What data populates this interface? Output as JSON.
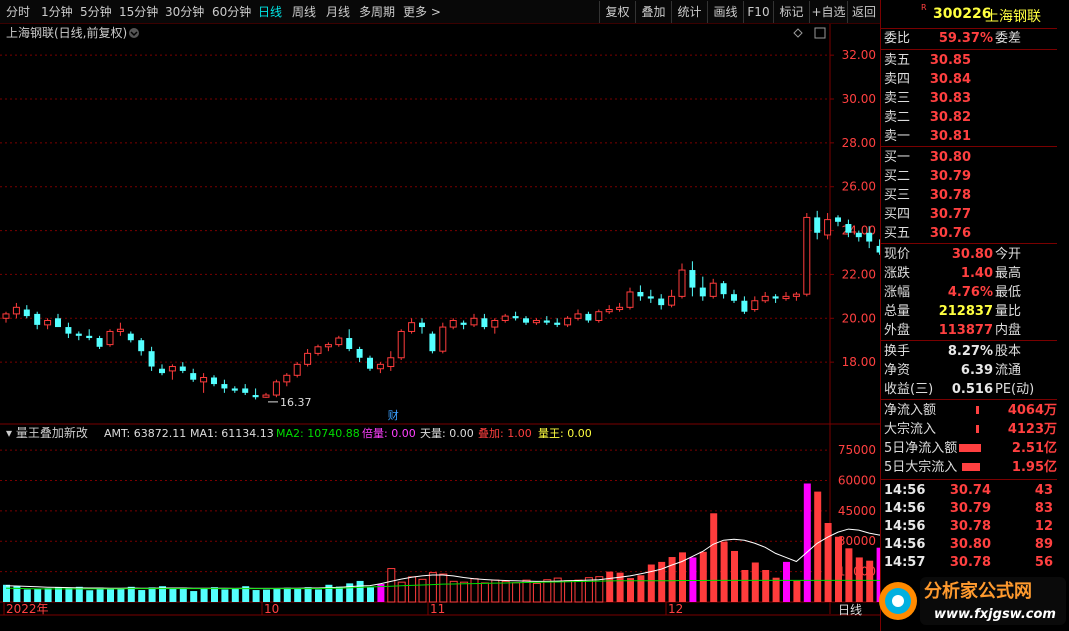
{
  "toolbar": {
    "periods": [
      "分时",
      "1分钟",
      "5分钟",
      "15分钟",
      "30分钟",
      "60分钟",
      "日线",
      "周线",
      "月线",
      "多周期",
      "更多 >"
    ],
    "selected": "日线",
    "actions": [
      "复权",
      "叠加",
      "统计",
      "画线",
      "F10",
      "标记",
      "+自选",
      "返回"
    ]
  },
  "main_chart": {
    "title": "上海钢联(日线,前复权)",
    "high_label": "32.00",
    "low_label": "16.37",
    "fin_marker": "财",
    "y_ticks": [
      "32.00",
      "30.00",
      "28.00",
      "26.00",
      "24.00",
      "22.00",
      "20.00",
      "18.00"
    ]
  },
  "indicator": {
    "name": "量王叠加新改",
    "amt": "AMT: 63872.11",
    "ma1": "MA1: 61134.13",
    "ma2": "MA2: 10740.88",
    "beiliang": "倍量: 0.00",
    "tianliang": "天量: 0.00",
    "diejia": "叠加: 1.00",
    "liangwang": "量王: 0.00",
    "y_ticks": [
      "75000",
      "60000",
      "45000",
      "30000",
      "15000"
    ]
  },
  "x_axis": {
    "labels": [
      "2022年",
      "10",
      "11",
      "12"
    ],
    "right_label": "日线"
  },
  "chart_data": {
    "type": "bar",
    "price_scale": [
      16.0,
      32.6
    ],
    "candles": [
      [
        20.0,
        20.3,
        19.8,
        20.2
      ],
      [
        20.2,
        20.7,
        20.0,
        20.5
      ],
      [
        20.4,
        20.6,
        20.0,
        20.1
      ],
      [
        20.2,
        20.3,
        19.5,
        19.7
      ],
      [
        19.7,
        20.0,
        19.5,
        19.9
      ],
      [
        20.0,
        20.2,
        19.6,
        19.6
      ],
      [
        19.6,
        19.8,
        19.1,
        19.3
      ],
      [
        19.3,
        19.4,
        19.0,
        19.2
      ],
      [
        19.2,
        19.5,
        19.0,
        19.1
      ],
      [
        19.1,
        19.2,
        18.6,
        18.7
      ],
      [
        18.8,
        19.5,
        18.7,
        19.4
      ],
      [
        19.4,
        19.8,
        19.2,
        19.5
      ],
      [
        19.3,
        19.4,
        18.9,
        19.0
      ],
      [
        19.0,
        19.1,
        18.3,
        18.5
      ],
      [
        18.5,
        18.7,
        17.6,
        17.8
      ],
      [
        17.7,
        17.9,
        17.4,
        17.5
      ],
      [
        17.6,
        17.9,
        17.2,
        17.8
      ],
      [
        17.8,
        18.0,
        17.5,
        17.6
      ],
      [
        17.5,
        17.7,
        17.1,
        17.2
      ],
      [
        17.1,
        17.5,
        16.6,
        17.3
      ],
      [
        17.3,
        17.4,
        16.9,
        17.0
      ],
      [
        17.0,
        17.2,
        16.6,
        16.8
      ],
      [
        16.8,
        16.9,
        16.6,
        16.7
      ],
      [
        16.8,
        17.0,
        16.5,
        16.6
      ],
      [
        16.5,
        16.8,
        16.3,
        16.4
      ],
      [
        16.4,
        16.6,
        16.37,
        16.5
      ],
      [
        16.5,
        17.2,
        16.4,
        17.1
      ],
      [
        17.1,
        17.5,
        16.9,
        17.4
      ],
      [
        17.4,
        18.0,
        17.3,
        17.9
      ],
      [
        17.9,
        18.6,
        17.8,
        18.4
      ],
      [
        18.4,
        18.8,
        18.3,
        18.7
      ],
      [
        18.7,
        18.9,
        18.5,
        18.8
      ],
      [
        18.8,
        19.2,
        18.7,
        19.1
      ],
      [
        19.1,
        19.5,
        18.5,
        18.6
      ],
      [
        18.6,
        18.7,
        18.0,
        18.2
      ],
      [
        18.2,
        18.3,
        17.6,
        17.7
      ],
      [
        17.7,
        18.0,
        17.5,
        17.9
      ],
      [
        17.8,
        18.5,
        17.6,
        18.2
      ],
      [
        18.2,
        19.5,
        18.1,
        19.4
      ],
      [
        19.4,
        20.0,
        19.3,
        19.8
      ],
      [
        19.8,
        20.0,
        19.3,
        19.6
      ],
      [
        19.3,
        19.4,
        18.4,
        18.5
      ],
      [
        18.5,
        19.8,
        18.4,
        19.6
      ],
      [
        19.6,
        20.0,
        19.5,
        19.9
      ],
      [
        19.8,
        19.9,
        19.5,
        19.7
      ],
      [
        19.7,
        20.2,
        19.6,
        20.0
      ],
      [
        20.0,
        20.2,
        19.5,
        19.6
      ],
      [
        19.6,
        20.0,
        19.3,
        19.9
      ],
      [
        19.9,
        20.2,
        19.8,
        20.1
      ],
      [
        20.1,
        20.3,
        19.9,
        20.0
      ],
      [
        20.0,
        20.1,
        19.7,
        19.8
      ],
      [
        19.8,
        20.0,
        19.7,
        19.9
      ],
      [
        19.9,
        20.1,
        19.7,
        19.8
      ],
      [
        19.8,
        20.0,
        19.6,
        19.7
      ],
      [
        19.7,
        20.1,
        19.6,
        20.0
      ],
      [
        20.0,
        20.4,
        19.9,
        20.2
      ],
      [
        20.2,
        20.3,
        19.8,
        19.9
      ],
      [
        19.9,
        20.4,
        19.8,
        20.3
      ],
      [
        20.3,
        20.6,
        20.2,
        20.4
      ],
      [
        20.4,
        20.7,
        20.3,
        20.5
      ],
      [
        20.5,
        21.4,
        20.4,
        21.2
      ],
      [
        21.2,
        21.5,
        20.8,
        21.0
      ],
      [
        21.0,
        21.3,
        20.7,
        20.9
      ],
      [
        20.9,
        21.1,
        20.4,
        20.6
      ],
      [
        20.6,
        21.3,
        20.5,
        21.0
      ],
      [
        21.0,
        22.5,
        20.9,
        22.2
      ],
      [
        22.2,
        22.6,
        21.0,
        21.4
      ],
      [
        21.4,
        21.9,
        20.8,
        21.0
      ],
      [
        21.0,
        21.8,
        20.9,
        21.6
      ],
      [
        21.6,
        21.7,
        20.9,
        21.1
      ],
      [
        21.1,
        21.3,
        20.7,
        20.8
      ],
      [
        20.8,
        21.0,
        20.2,
        20.3
      ],
      [
        20.4,
        21.0,
        20.3,
        20.8
      ],
      [
        20.8,
        21.2,
        20.7,
        21.0
      ],
      [
        21.0,
        21.1,
        20.7,
        20.9
      ],
      [
        20.9,
        21.2,
        20.8,
        21.0
      ],
      [
        21.0,
        21.2,
        20.8,
        21.1
      ],
      [
        21.1,
        24.8,
        21.0,
        24.6
      ],
      [
        24.6,
        24.9,
        23.6,
        23.9
      ],
      [
        23.8,
        24.8,
        23.6,
        24.5
      ],
      [
        24.6,
        24.7,
        24.2,
        24.4
      ],
      [
        24.3,
        24.5,
        23.7,
        23.9
      ],
      [
        23.9,
        24.0,
        23.5,
        23.7
      ],
      [
        23.9,
        24.2,
        23.2,
        23.5
      ],
      [
        23.3,
        23.6,
        22.9,
        23.0
      ],
      [
        23.5,
        24.8,
        23.4,
        24.6
      ],
      [
        24.6,
        26.5,
        24.4,
        26.2
      ],
      [
        26.1,
        26.6,
        25.2,
        25.6
      ],
      [
        25.6,
        26.6,
        25.4,
        26.5
      ],
      [
        26.4,
        27.0,
        26.0,
        26.2
      ],
      [
        26.2,
        29.3,
        26.0,
        29.0
      ],
      [
        28.5,
        30.4,
        28.3,
        30.0
      ],
      [
        29.6,
        32.0,
        29.3,
        31.5
      ],
      [
        30.5,
        32.2,
        28.9,
        30.8
      ]
    ],
    "volume_scale": [
      0,
      78000
    ],
    "volumes": [
      8500,
      7800,
      6200,
      6500,
      6800,
      7200,
      6900,
      7500,
      5800,
      7100,
      6400,
      6800,
      7500,
      5900,
      7200,
      7800,
      6500,
      7100,
      5400,
      6900,
      7300,
      6200,
      6700,
      7800,
      5900,
      6100,
      6400,
      7000,
      6500,
      7300,
      6200,
      8500,
      7600,
      9200,
      10400,
      7200,
      8900,
      16500,
      9800,
      12400,
      11200,
      14500,
      13800,
      10200,
      9800,
      11500,
      9400,
      10800,
      10200,
      9500,
      10800,
      9200,
      11000,
      11800,
      10500,
      10800,
      12000,
      12500,
      15000,
      14500,
      11800,
      13200,
      18500,
      19800,
      22200,
      24500,
      22000,
      24800,
      43800,
      29800,
      25200,
      15800,
      19500,
      15800,
      12000,
      19800,
      10400,
      58500,
      54500,
      39000,
      32200,
      26500,
      22000,
      20400,
      26800,
      60700,
      44900,
      61000,
      74600,
      63000
    ],
    "volume_colors": [
      "c",
      "c",
      "c",
      "c",
      "c",
      "c",
      "c",
      "c",
      "c",
      "c",
      "c",
      "c",
      "c",
      "c",
      "c",
      "c",
      "c",
      "c",
      "c",
      "c",
      "c",
      "c",
      "c",
      "c",
      "c",
      "c",
      "c",
      "c",
      "c",
      "c",
      "c",
      "c",
      "c",
      "c",
      "c",
      "c",
      "m",
      "r",
      "r",
      "r",
      "r",
      "r",
      "r",
      "r",
      "r",
      "r",
      "r",
      "r",
      "r",
      "r",
      "r",
      "r",
      "r",
      "r",
      "r",
      "r",
      "r",
      "r",
      "R",
      "R",
      "R",
      "R",
      "R",
      "R",
      "R",
      "R",
      "M",
      "R",
      "R",
      "R",
      "R",
      "R",
      "R",
      "R",
      "R",
      "M",
      "R",
      "M",
      "R",
      "R",
      "R",
      "R",
      "R",
      "R",
      "M",
      "R",
      "W",
      "W",
      "R",
      "R"
    ],
    "ma1_line": [
      8000,
      7900,
      7700,
      7500,
      7300,
      7200,
      7100,
      7000,
      6900,
      6900,
      6800,
      6800,
      6900,
      6800,
      6800,
      6900,
      6900,
      6900,
      6800,
      6800,
      6800,
      6800,
      6700,
      6800,
      6700,
      6700,
      6700,
      6800,
      6800,
      6900,
      6900,
      7100,
      7200,
      7600,
      7900,
      8100,
      9000,
      10200,
      11300,
      12200,
      12900,
      13300,
      13300,
      12900,
      12100,
      11500,
      11100,
      10800,
      10600,
      10500,
      10300,
      10200,
      10200,
      10300,
      10500,
      10600,
      10800,
      11000,
      11600,
      12200,
      12900,
      13900,
      15000,
      16200,
      18200,
      20000,
      22500,
      25000,
      28500,
      30500,
      31000,
      30500,
      29000,
      27000,
      24000,
      22000,
      20000,
      24500,
      29000,
      32000,
      34500,
      36000,
      35500,
      34000,
      33000,
      36500,
      39000,
      43500,
      49000,
      54500
    ],
    "ma2_line": [
      6800,
      6700,
      6600,
      6500,
      6500,
      6500,
      6500,
      6500,
      6500,
      6500,
      6500,
      6500,
      6600,
      6600,
      6600,
      6600,
      6600,
      6600,
      6600,
      6600,
      6600,
      6600,
      6600,
      6600,
      6600,
      6600,
      6600,
      6600,
      6600,
      6600,
      6600,
      6700,
      6800,
      7000,
      7200,
      7400,
      7600,
      7800,
      8000,
      8200,
      8400,
      8600,
      8800,
      8900,
      9000,
      9100,
      9200,
      9300,
      9400,
      9500,
      9600,
      9700,
      9800,
      9900,
      10000,
      10100,
      10200,
      10300,
      10400,
      10500,
      10500,
      10500,
      10500,
      10500,
      10500,
      10600,
      10600,
      10600,
      10700,
      10700,
      10700,
      10700,
      10700,
      10700,
      10700,
      10700,
      10700,
      10700,
      10700,
      10700,
      10700,
      10700,
      10700,
      10700,
      10700,
      10700,
      10700,
      10700,
      10740,
      10740
    ]
  },
  "side_panel": {
    "code": "300226",
    "name": "上海钢联",
    "r_tag": "R",
    "weibi_label": "委比",
    "weibi_value": "59.37%",
    "weicha_label": "委差",
    "asks": [
      {
        "label": "卖五",
        "price": "30.85"
      },
      {
        "label": "卖四",
        "price": "30.84"
      },
      {
        "label": "卖三",
        "price": "30.83"
      },
      {
        "label": "卖二",
        "price": "30.82"
      },
      {
        "label": "卖一",
        "price": "30.81"
      }
    ],
    "bids": [
      {
        "label": "买一",
        "price": "30.80"
      },
      {
        "label": "买二",
        "price": "30.79"
      },
      {
        "label": "买三",
        "price": "30.78"
      },
      {
        "label": "买四",
        "price": "30.77"
      },
      {
        "label": "买五",
        "price": "30.76"
      }
    ],
    "quote": [
      {
        "label": "现价",
        "value": "30.80",
        "label2": "今开",
        "color": "red"
      },
      {
        "label": "涨跌",
        "value": "1.40",
        "label2": "最高",
        "color": "red"
      },
      {
        "label": "涨幅",
        "value": "4.76%",
        "label2": "最低",
        "color": "red"
      },
      {
        "label": "总量",
        "value": "212837",
        "label2": "量比",
        "color": "yel"
      },
      {
        "label": "外盘",
        "value": "113877",
        "label2": "内盘",
        "color": "red"
      }
    ],
    "stats": [
      {
        "label": "换手",
        "value": "8.27%",
        "label2": "股本"
      },
      {
        "label": "净资",
        "value": "6.39",
        "label2": "流通"
      },
      {
        "label": "收益(三)",
        "value": "0.516",
        "label2": "PE(动)"
      }
    ],
    "flows": [
      {
        "label": "净流入额",
        "value": "4064万",
        "bar": 0.06
      },
      {
        "label": "大宗流入",
        "value": "4123万",
        "bar": 0.06
      },
      {
        "label": "5日净流入额",
        "value": "2.51亿",
        "bar": 0.55
      },
      {
        "label": "5日大宗流入",
        "value": "1.95亿",
        "bar": 0.45
      }
    ],
    "ticks": [
      {
        "time": "14:56",
        "price": "30.74",
        "vol": "43"
      },
      {
        "time": "14:56",
        "price": "30.79",
        "vol": "83"
      },
      {
        "time": "14:56",
        "price": "30.78",
        "vol": "12"
      },
      {
        "time": "14:56",
        "price": "30.80",
        "vol": "89"
      },
      {
        "time": "14:57",
        "price": "30.78",
        "vol": "56"
      }
    ]
  },
  "watermark": {
    "cn": "分析家公式网",
    "url": "www.fxjgsw.com"
  },
  "colors": {
    "up": "#ff3c3c",
    "down": "#54ffff",
    "magenta": "#ff00ff",
    "grid": "#7a0000",
    "white": "#ffffff"
  }
}
